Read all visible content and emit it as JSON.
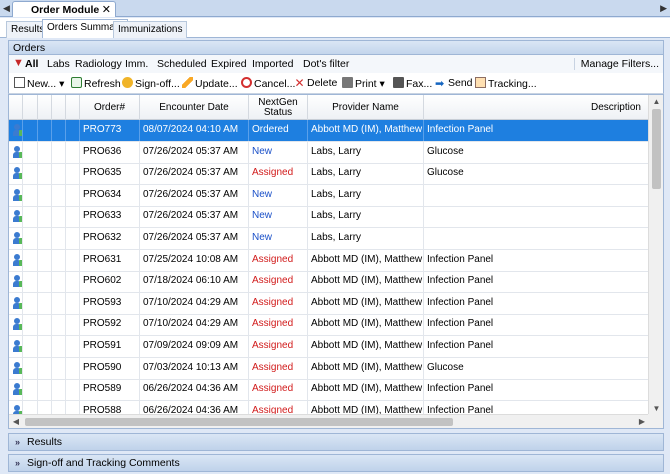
{
  "module_tab": {
    "label": "Order Module",
    "close": "✕"
  },
  "nav": {
    "left": "◀",
    "right": "▶"
  },
  "tabs": [
    {
      "label": "Results"
    },
    {
      "label": "Orders Summary",
      "active": true
    },
    {
      "label": "Immunizations"
    }
  ],
  "orders_header": "Orders",
  "filters": {
    "items": [
      "All",
      "Labs",
      "Radiology",
      "Imm.",
      "Scheduled",
      "Expired",
      "Imported",
      "Dot's filter"
    ],
    "selected": "All",
    "manage": "Manage Filters..."
  },
  "toolbar": {
    "new": "New...",
    "refresh": "Refresh",
    "signoff": "Sign-off...",
    "update": "Update...",
    "cancel": "Cancel...",
    "delete": "Delete",
    "print": "Print",
    "fax": "Fax...",
    "send": "Send",
    "tracking": "Tracking..."
  },
  "columns": {
    "order": "Order#",
    "encounter": "Encounter Date",
    "status": "NextGen Status",
    "provider": "Provider Name",
    "description": "Description"
  },
  "rows": [
    {
      "order": "PRO773",
      "date": "08/07/2024 04:10 AM",
      "status": "Ordered",
      "provider": "Abbott MD (IM), Matthew IM",
      "desc": "Infection Panel",
      "selected": true
    },
    {
      "order": "PRO636",
      "date": "07/26/2024 05:37 AM",
      "status": "New",
      "provider": "Labs, Larry",
      "desc": "Glucose"
    },
    {
      "order": "PRO635",
      "date": "07/26/2024 05:37 AM",
      "status": "Assigned",
      "provider": "Labs, Larry",
      "desc": "Glucose"
    },
    {
      "order": "PRO634",
      "date": "07/26/2024 05:37 AM",
      "status": "New",
      "provider": "Labs, Larry",
      "desc": ""
    },
    {
      "order": "PRO633",
      "date": "07/26/2024 05:37 AM",
      "status": "New",
      "provider": "Labs, Larry",
      "desc": ""
    },
    {
      "order": "PRO632",
      "date": "07/26/2024 05:37 AM",
      "status": "New",
      "provider": "Labs, Larry",
      "desc": ""
    },
    {
      "order": "PRO631",
      "date": "07/25/2024 10:08 AM",
      "status": "Assigned",
      "provider": "Abbott MD (IM), Matthew IM",
      "desc": "Infection Panel"
    },
    {
      "order": "PRO602",
      "date": "07/18/2024 06:10 AM",
      "status": "Assigned",
      "provider": "Abbott MD (IM), Matthew IM",
      "desc": "Infection Panel"
    },
    {
      "order": "PRO593",
      "date": "07/10/2024 04:29 AM",
      "status": "Assigned",
      "provider": "Abbott MD (IM), Matthew IM",
      "desc": "Infection Panel"
    },
    {
      "order": "PRO592",
      "date": "07/10/2024 04:29 AM",
      "status": "Assigned",
      "provider": "Abbott MD (IM), Matthew IM",
      "desc": "Infection Panel"
    },
    {
      "order": "PRO591",
      "date": "07/09/2024 09:09 AM",
      "status": "Assigned",
      "provider": "Abbott MD (IM), Matthew IM",
      "desc": "Infection Panel"
    },
    {
      "order": "PRO590",
      "date": "07/03/2024 10:13 AM",
      "status": "Assigned",
      "provider": "Abbott MD (IM), Matthew IM",
      "desc": "Glucose"
    },
    {
      "order": "PRO589",
      "date": "06/26/2024 04:36 AM",
      "status": "Assigned",
      "provider": "Abbott MD (IM), Matthew IM",
      "desc": "Infection Panel"
    },
    {
      "order": "PRO588",
      "date": "06/26/2024 04:36 AM",
      "status": "Assigned",
      "provider": "Abbott MD (IM), Matthew IM",
      "desc": "Infection Panel"
    }
  ],
  "panels": {
    "results": "Results",
    "signoff": "Sign-off and Tracking Comments"
  },
  "colors": {
    "selection": "#1e7fe0",
    "status_new": "#1a50c8",
    "status_assigned": "#d11a1a"
  }
}
